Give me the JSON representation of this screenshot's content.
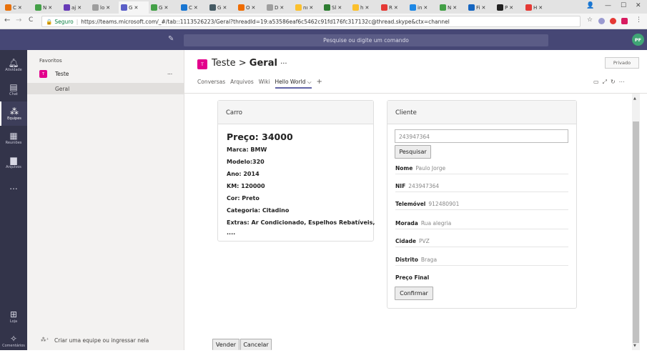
{
  "browser": {
    "tabs": [
      {
        "label": "C",
        "color": "#e8710a"
      },
      {
        "label": "N",
        "color": "#43a047"
      },
      {
        "label": "aj",
        "color": "#673ab7"
      },
      {
        "label": "lo",
        "color": "#9e9e9e"
      },
      {
        "label": "G",
        "color": "#5b5fc7",
        "active": true
      },
      {
        "label": "G",
        "color": "#43a047"
      },
      {
        "label": "C",
        "color": "#1976d2"
      },
      {
        "label": "G",
        "color": "#455a64"
      },
      {
        "label": "O",
        "color": "#ef6c00"
      },
      {
        "label": "D",
        "color": "#9e9e9e"
      },
      {
        "label": "nı",
        "color": "#fbc02d"
      },
      {
        "label": "Sl",
        "color": "#2e7d32"
      },
      {
        "label": "h",
        "color": "#fbc02d"
      },
      {
        "label": "R",
        "color": "#e53935"
      },
      {
        "label": "in",
        "color": "#1e88e5"
      },
      {
        "label": "N",
        "color": "#43a047"
      },
      {
        "label": "Fi",
        "color": "#1565c0"
      },
      {
        "label": "P",
        "color": "#212121"
      },
      {
        "label": "H",
        "color": "#e53935"
      }
    ],
    "url_secure_label": "Seguro",
    "url": "https://teams.microsoft.com/_#/tab::1113526223/Geral?threadId=19:a53586eaf6c5462c91fd176fc317132c@thread.skype&ctx=channel"
  },
  "topbar": {
    "search_placeholder": "Pesquise ou digite um comando",
    "avatar_initials": "PF"
  },
  "rail": {
    "items": [
      {
        "label": "Atividade",
        "icon": "bell-icon"
      },
      {
        "label": "Chat",
        "icon": "chat-icon"
      },
      {
        "label": "Equipes",
        "icon": "teams-icon",
        "active": true
      },
      {
        "label": "Reuniões",
        "icon": "calendar-icon"
      },
      {
        "label": "Arquivos",
        "icon": "file-icon"
      },
      {
        "label": "...",
        "icon": "more-icon"
      }
    ],
    "bottom": [
      {
        "label": "Loja",
        "icon": "store-icon"
      },
      {
        "label": "Comentários",
        "icon": "feedback-icon"
      }
    ]
  },
  "panel": {
    "favorites_label": "Favoritos",
    "team_name": "Teste",
    "team_initial": "T",
    "team_more": "...",
    "channel": "Geral",
    "create_team_link": "Criar uma equipe ou ingressar nela"
  },
  "header": {
    "team_initial": "T",
    "team": "Teste",
    "sep": ">",
    "channel": "Geral",
    "more": "···",
    "privacy": "Privado",
    "tabs": [
      "Conversas",
      "Arquivos",
      "Wiki"
    ],
    "active_tab": "Hello World",
    "add_tab": "+"
  },
  "car": {
    "heading": "Carro",
    "price": "Preço: 34000",
    "marca": "Marca: BMW",
    "modelo": "Modelo:320",
    "ano": "Ano: 2014",
    "km": "KM: 120000",
    "cor": "Cor: Preto",
    "categoria": "Categoria: Citadino",
    "extras": "Extras: Ar Condicionado, Espelhos Rebatíveis,",
    "extras_more": "...."
  },
  "client": {
    "heading": "Cliente",
    "search_value": "243947364",
    "search_button": "Pesquisar",
    "fields": [
      {
        "label": "Nome",
        "value": "Paulo Jorge"
      },
      {
        "label": "NIF",
        "value": "243947364"
      },
      {
        "label": "Telemóvel",
        "value": "912480901"
      },
      {
        "label": "Morada",
        "value": "Rua alegria"
      },
      {
        "label": "Cidade",
        "value": "PVZ"
      },
      {
        "label": "Distrito",
        "value": "Braga"
      },
      {
        "label": "Preço Final",
        "value": ""
      }
    ],
    "confirm_button": "Confirmar"
  },
  "actions": {
    "sell": "Vender",
    "cancel": "Cancelar"
  }
}
